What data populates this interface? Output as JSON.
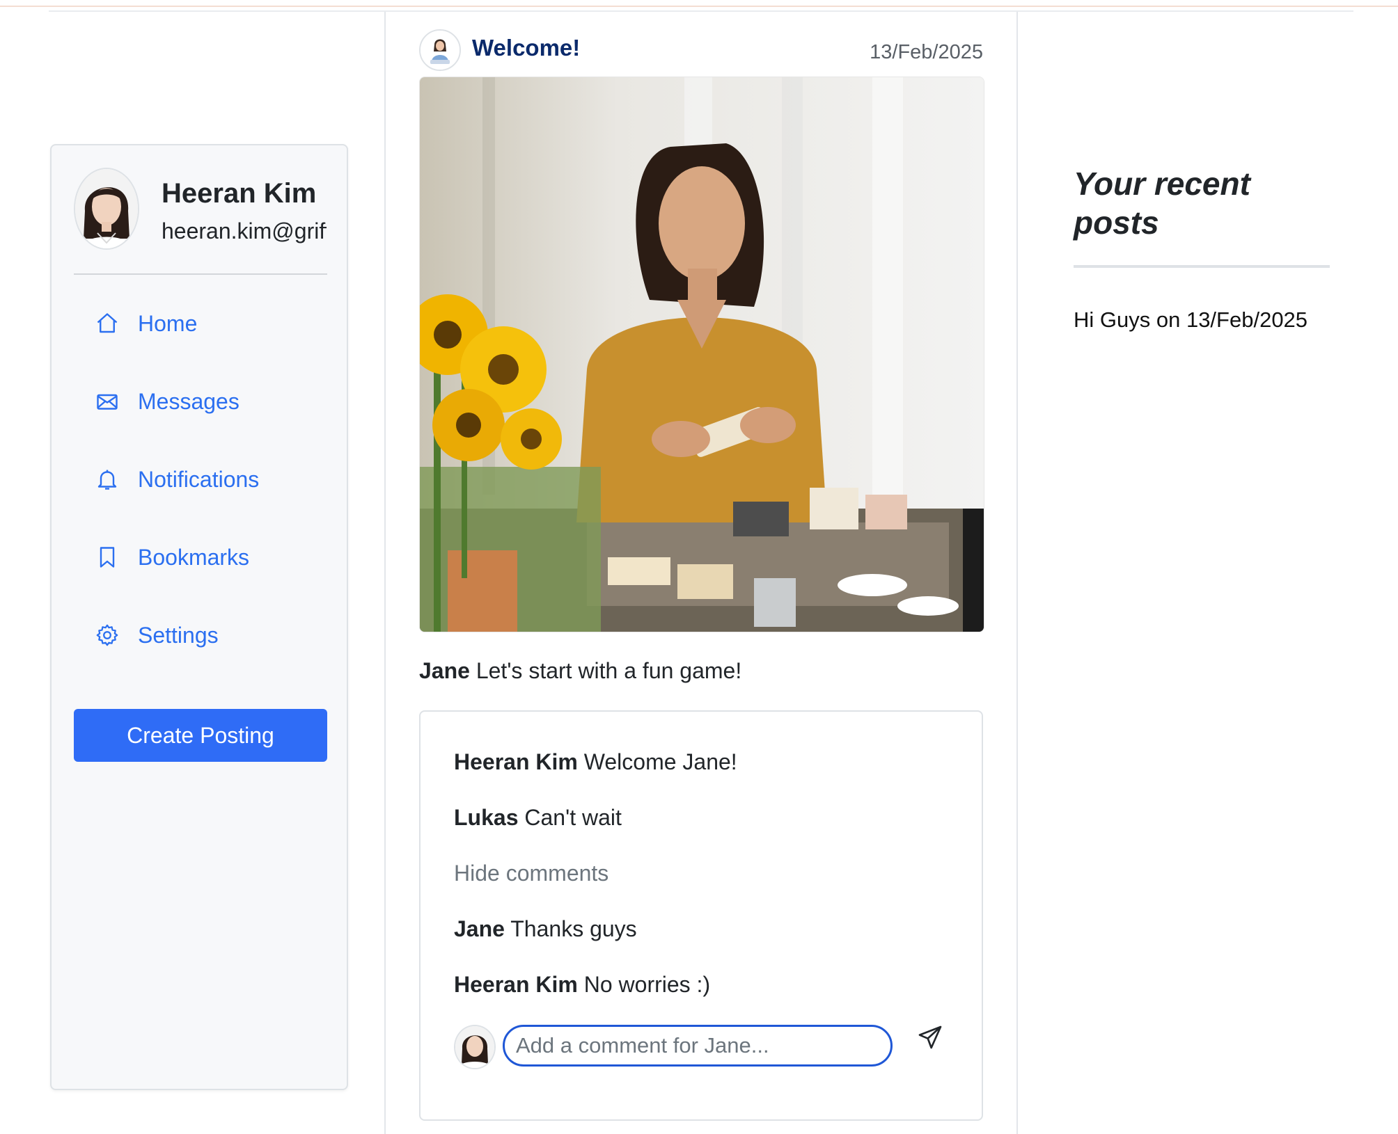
{
  "profile": {
    "name": "Heeran Kim",
    "email": "heeran.kim@griffith.edu.au"
  },
  "nav": {
    "items": [
      {
        "label": "Home",
        "icon": "home-icon"
      },
      {
        "label": "Messages",
        "icon": "envelope-icon"
      },
      {
        "label": "Notifications",
        "icon": "bell-icon"
      },
      {
        "label": "Bookmarks",
        "icon": "bookmark-icon"
      },
      {
        "label": "Settings",
        "icon": "gear-icon"
      }
    ]
  },
  "create_button": {
    "label": "Create Posting"
  },
  "post": {
    "title": "Welcome!",
    "date": "13/Feb/2025",
    "author": "Jane",
    "text": "Let's start with a fun game!"
  },
  "comments": {
    "items": [
      {
        "author": "Heeran Kim",
        "text": "Welcome Jane!"
      },
      {
        "author": "Lukas",
        "text": "Can't wait"
      }
    ],
    "hide_label": "Hide comments",
    "replies": [
      {
        "author": "Jane",
        "text": "Thanks guys"
      },
      {
        "author": "Heeran Kim",
        "text": "No worries :)"
      }
    ],
    "input_placeholder": "Add a comment for Jane..."
  },
  "recent": {
    "title": "Your recent posts",
    "items": [
      {
        "text": "Hi Guys on 13/Feb/2025"
      }
    ]
  },
  "colors": {
    "accent": "#2f6cf6",
    "link": "#2b6ff0",
    "title": "#0b2a6b",
    "input_border": "#1f57d6"
  }
}
